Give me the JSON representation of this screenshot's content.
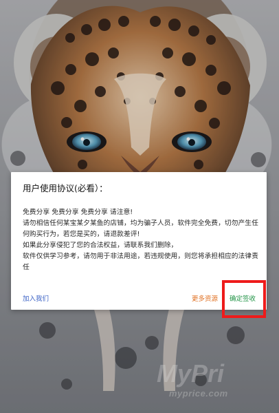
{
  "dialog": {
    "title": "用户使用协议(必看）：",
    "lines": [
      "免费分享 免费分享 免费分享 请注意!",
      "请勿相信任何某宝某夕某鱼的店铺，均为骗子人员，软件完全免费，切勿产生任何购买行为，若您是买的，请退款差评!",
      "如果此分享侵犯了您的合法权益，请联系我们删除，",
      "软件仅供学习参考，请勿用于非法用途，若违规使用，则您将承担相应的法律责任"
    ],
    "actions": {
      "join": "加入我们",
      "more": "更多资源",
      "confirm": "确定签收"
    }
  },
  "watermark": {
    "main": "MyPri",
    "sub": "myprice.com"
  },
  "colors": {
    "dialog_background": "#ffffff",
    "join_action": "#3b62c5",
    "more_action": "#e07022",
    "confirm_action": "#229447",
    "highlight_box": "#ee1b1b"
  }
}
